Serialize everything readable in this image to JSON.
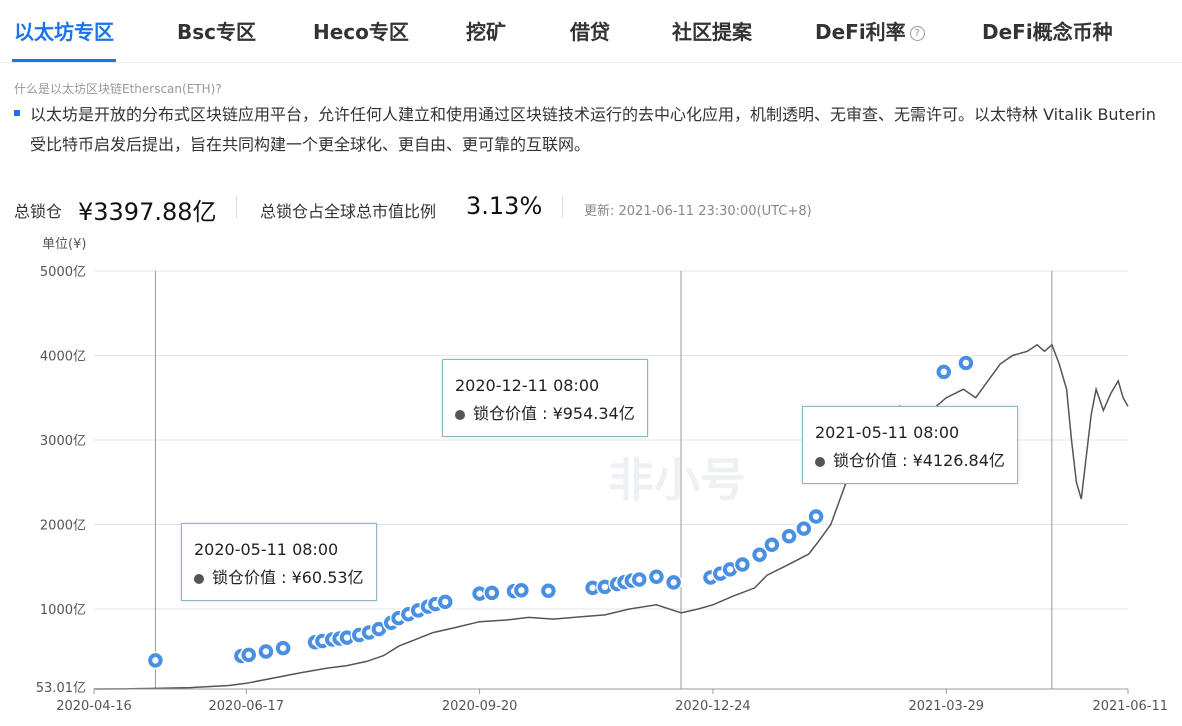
{
  "tabs": [
    {
      "label": "以太坊专区",
      "active": true
    },
    {
      "label": "Bsc专区",
      "active": false
    },
    {
      "label": "Heco专区",
      "active": false
    },
    {
      "label": "挖矿",
      "active": false
    },
    {
      "label": "借贷",
      "active": false
    },
    {
      "label": "社区提案",
      "active": false
    },
    {
      "label": "DeFi利率",
      "active": false,
      "help": "?"
    },
    {
      "label": "DeFi概念币种",
      "active": false
    }
  ],
  "info": {
    "question": "什么是以太坊区块链Etherscan(ETH)?",
    "description": "以太坊是开放的分布式区块链应用平台，允许任何人建立和使用通过区块链技术运行的去中心化应用，机制透明、无审查、无需许可。以太特林 Vitalik Buterin 受比特币启发后提出，旨在共同构建一个更全球化、更自由、更可靠的互联网。"
  },
  "stats": {
    "tvl_label": "总锁仓",
    "tvl_value": "¥3397.88亿",
    "ratio_label": "总锁仓占全球总市值比例",
    "ratio_value": "3.13%",
    "updated": "更新: 2021-06-11 23:30:00(UTC+8)"
  },
  "colors": {
    "accent": "#1a73e8",
    "line": "#555555",
    "marker": "#4a90e2",
    "grid": "#e5e5e5"
  },
  "chart_data": {
    "type": "line",
    "ylabel": "单位(¥)",
    "y_min_label": "53.01亿",
    "yticks": [
      1000,
      2000,
      3000,
      4000,
      5000
    ],
    "ytick_labels": [
      "1000亿",
      "2000亿",
      "3000亿",
      "4000亿",
      "5000亿"
    ],
    "ylim": [
      53.01,
      5000
    ],
    "xtick_labels": [
      "2020-04-16",
      "2020-06-17",
      "2020-09-20",
      "2020-12-24",
      "2021-03-29",
      "2021-06-11"
    ],
    "xtick_dates": [
      "2020-04-16",
      "2020-06-17",
      "2020-09-20",
      "2020-12-24",
      "2021-03-29",
      "2021-06-11"
    ],
    "xlim": [
      "2020-04-16",
      "2021-06-11"
    ],
    "series": [
      {
        "x": [
          "2020-04-16",
          "2020-05-01",
          "2020-05-11",
          "2020-05-25",
          "2020-06-10",
          "2020-06-17",
          "2020-07-01",
          "2020-07-10",
          "2020-07-20",
          "2020-07-28",
          "2020-08-05",
          "2020-08-12",
          "2020-08-18",
          "2020-08-25",
          "2020-09-01",
          "2020-09-10",
          "2020-09-20",
          "2020-10-01",
          "2020-10-10",
          "2020-10-20",
          "2020-11-01",
          "2020-11-10",
          "2020-11-20",
          "2020-12-01",
          "2020-12-11",
          "2020-12-18",
          "2020-12-24",
          "2021-01-01",
          "2021-01-10",
          "2021-01-15",
          "2021-01-22",
          "2021-02-01",
          "2021-02-05",
          "2021-02-10",
          "2021-02-15",
          "2021-02-20",
          "2021-02-25",
          "2021-03-01",
          "2021-03-05",
          "2021-03-10",
          "2021-03-15",
          "2021-03-20",
          "2021-03-25",
          "2021-03-29",
          "2021-04-05",
          "2021-04-10",
          "2021-04-15",
          "2021-04-20",
          "2021-04-25",
          "2021-05-01",
          "2021-05-05",
          "2021-05-08",
          "2021-05-11",
          "2021-05-14",
          "2021-05-17",
          "2021-05-19",
          "2021-05-21",
          "2021-05-23",
          "2021-05-25",
          "2021-05-27",
          "2021-05-29",
          "2021-06-01",
          "2021-06-04",
          "2021-06-07",
          "2021-06-09",
          "2021-06-11"
        ],
        "y": [
          45,
          55,
          60.53,
          70,
          95,
          120,
          200,
          250,
          300,
          330,
          380,
          450,
          560,
          640,
          720,
          780,
          850,
          870,
          900,
          880,
          910,
          930,
          1000,
          1050,
          954.34,
          1000,
          1050,
          1150,
          1250,
          1400,
          1500,
          1650,
          1800,
          2000,
          2400,
          2800,
          3000,
          3100,
          3200,
          3400,
          3300,
          3300,
          3400,
          3500,
          3600,
          3500,
          3700,
          3900,
          4000,
          4050,
          4126.84,
          4050,
          4126.84,
          3900,
          3600,
          3000,
          2500,
          2300,
          2800,
          3300,
          3600,
          3350,
          3550,
          3700,
          3500,
          3397.88
        ]
      }
    ],
    "markers": [
      "2020-05-11",
      "2020-06-15",
      "2020-06-18",
      "2020-06-25",
      "2020-07-02",
      "2020-07-15",
      "2020-07-18",
      "2020-07-22",
      "2020-07-25",
      "2020-07-28",
      "2020-08-02",
      "2020-08-06",
      "2020-08-10",
      "2020-08-15",
      "2020-08-18",
      "2020-08-22",
      "2020-08-26",
      "2020-08-30",
      "2020-09-02",
      "2020-09-06",
      "2020-09-20",
      "2020-09-25",
      "2020-10-04",
      "2020-10-07",
      "2020-10-18",
      "2020-11-05",
      "2020-11-10",
      "2020-11-15",
      "2020-11-18",
      "2020-11-21",
      "2020-11-24",
      "2020-12-01",
      "2020-12-08",
      "2020-12-23",
      "2020-12-27",
      "2020-12-31",
      "2021-01-05",
      "2021-01-12",
      "2021-01-17",
      "2021-01-24",
      "2021-01-30",
      "2021-02-04",
      "2021-02-18",
      "2021-03-28",
      "2021-04-06"
    ],
    "vlines": [
      "2020-05-11",
      "2020-12-11",
      "2021-05-11"
    ],
    "tooltips": [
      {
        "date": "2020-05-11 08:00",
        "label": "锁仓价值 : ¥60.53亿"
      },
      {
        "date": "2020-12-11 08:00",
        "label": "锁仓价值 : ¥954.34亿"
      },
      {
        "date": "2021-05-11 08:00",
        "label": "锁仓价值 : ¥4126.84亿"
      }
    ],
    "watermark": "非小号"
  }
}
